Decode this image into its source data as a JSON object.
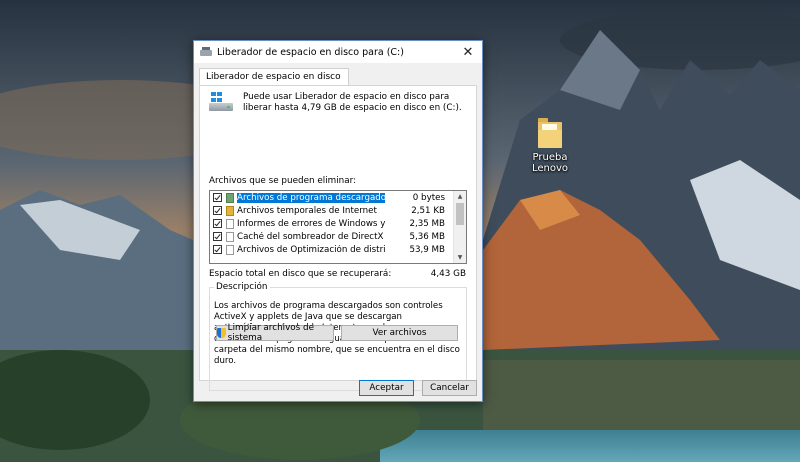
{
  "window": {
    "title": "Liberador de espacio en disco para  (C:)",
    "close_glyph": "✕"
  },
  "tab": {
    "label": "Liberador de espacio en disco"
  },
  "intro": {
    "text": "Puede usar Liberador de espacio en disco para liberar hasta 4,79 GB de espacio en disco en  (C:)."
  },
  "files": {
    "label": "Archivos que se pueden eliminar:",
    "items": [
      {
        "name": "Archivos de programa descargados",
        "size": "0 bytes",
        "checked": true,
        "icon": "folder-green-icon"
      },
      {
        "name": "Archivos temporales de Internet",
        "size": "2,51 KB",
        "checked": true,
        "icon": "lock-icon"
      },
      {
        "name": "Informes de errores de Windows y diag...",
        "size": "2,35 MB",
        "checked": true,
        "icon": "file-icon"
      },
      {
        "name": "Caché del sombreador de DirectX",
        "size": "5,36 MB",
        "checked": true,
        "icon": "file-icon"
      },
      {
        "name": "Archivos de Optimización de distribución",
        "size": "53,9 MB",
        "checked": true,
        "icon": "file-icon"
      }
    ]
  },
  "total": {
    "label": "Espacio total en disco que se recuperará:",
    "value": "4,43 GB"
  },
  "description": {
    "title": "Descripción",
    "text": "Los archivos de programa descargados son controles ActiveX y applets de Java que se descargan automáticamente desde Internet cuando se ven determinadas páginas. Se guardan temporalmente en la carpeta del mismo nombre, que se encuentra en el disco duro."
  },
  "buttons": {
    "clean_system": "Limpiar archivos de sistema",
    "view_files": "Ver archivos",
    "accept": "Aceptar",
    "cancel": "Cancelar"
  },
  "desktop": {
    "icon_label": "Prueba Lenovo"
  },
  "colors": {
    "accent": "#0078d7",
    "titlebar_border": "#6b8fc5"
  }
}
